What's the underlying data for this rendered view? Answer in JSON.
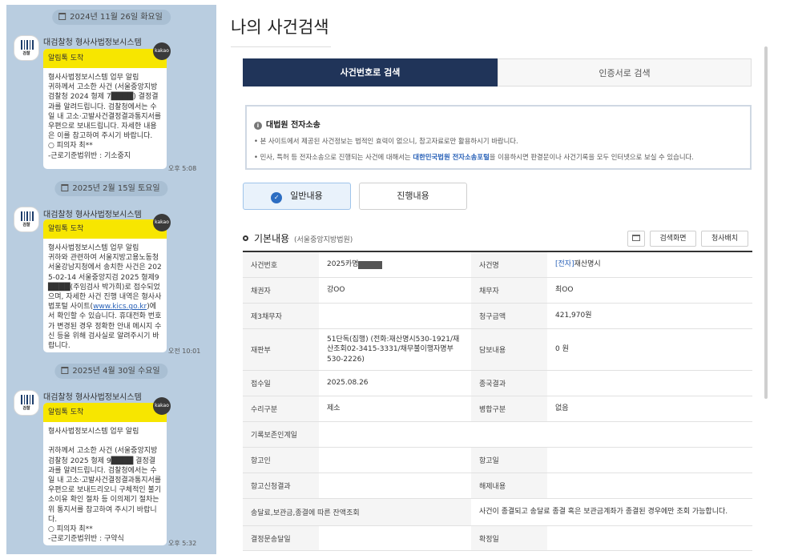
{
  "chat": {
    "sender": "대검찰청 형사사법정보시스템",
    "avatar_label": "검찰",
    "kakao_label": "kakao",
    "messages": [
      {
        "date": "2024년 11월 26일 화요일",
        "header": "알림톡 도착",
        "body": "형사사법정보시스템 업무 알림\n귀하께서 고소한 사건 (서울중앙지방검찰청 2024 형제 7████) 결정결과를 알려드립니다. 검찰청에서는 수일 내 고소·고발사건결정결과통지서를 우편으로 보내드립니다. 자세한 내용은 이를 참고하여 주시기 바랍니다.\n○ 피의자 최**\n-근로기준법위반 : 기소중지",
        "time": "오후 5:08"
      },
      {
        "date": "2025년 2월 15일 토요일",
        "header": "알림톡 도착",
        "body_before_link": "형사사법정보시스템 업무 알림\n귀하와 관련하여 서울지방고용노동청 서울강남지청에서 송치한 사건은 2025-02-14 서울중앙지검 2025 형제9████(주임검사 박가희)로 접수되었으며, 자세한 사건 진행 내역은 형사사법포털 사이트(",
        "link": "www.kics.go.kr",
        "body_after_link": ")에서 확인할 수 있습니다. 휴대전화 번호가 변경된 경우 정확한 안내 메시지 수신 등을 위해 검사실로 알려주시기 바랍니다.",
        "time": "오전 10:01"
      },
      {
        "date": "2025년 4월 30일 수요일",
        "header": "알림톡 도착",
        "body": "형사사법정보시스템 업무 알림\n\n귀하께서 고소한 사건 (서울중앙지방검찰청 2025 형제 9████ 결정결과를 알려드립니다. 검찰청에서는 수일 내 고소·고발사건결정결과통지서를 우편으로 보내드리오니 구체적인 불기소이유 확인 절차 등 이의제기 절차는 위 통지서를 참고하여 주시기 바랍니다.\n○ 피의자 최**\n-근로기준법위반 : 구약식",
        "time": "오후 5:32"
      }
    ]
  },
  "main": {
    "title": "나의 사건검색",
    "tabs": [
      "사건번호로 검색",
      "인증서로 검색"
    ],
    "notice": {
      "title": "대법원 전자소송",
      "line1": "• 본 사이트에서 제공된 사건정보는 법적인 효력이 없으니, 참고자료로만 활용하시기 바랍니다.",
      "line2_before": "• 민사, 특허 등 전자소송으로 진행되는 사건에 대해서는 ",
      "line2_link": "대한민국법원 전자소송포털",
      "line2_after": "을 이용하시면 판결문이나 사건기록을 모두 인터넷으로 보실 수 있습니다."
    },
    "sub_tabs": [
      "일반내용",
      "진행내용"
    ],
    "section": {
      "title": "기본내용",
      "court": "(서울중앙지방법원)",
      "buttons": [
        "검색화면",
        "청사배치"
      ]
    },
    "table": {
      "rows": [
        {
          "l1": "사건번호",
          "v1": "2025카명",
          "l2": "사건명",
          "v2_tag": "[전자]",
          "v2": "재산명시"
        },
        {
          "l1": "채권자",
          "v1": "강OO",
          "l2": "채무자",
          "v2": "최OO"
        },
        {
          "l1": "제3채무자",
          "v1": "",
          "l2": "청구금액",
          "v2": "421,970원"
        },
        {
          "l1": "재판부",
          "v1": "51단독(집행) (전화:재산명시530-1921/재산조회02-3415-3331/채무불이행자명부530-2226)",
          "l2": "담보내용",
          "v2": "0 원"
        },
        {
          "l1": "접수일",
          "v1": "2025.08.26",
          "l2": "종국결과",
          "v2": ""
        },
        {
          "l1": "수리구분",
          "v1": "제소",
          "l2": "병합구분",
          "v2": "없음"
        },
        {
          "l1": "기록보존인계일",
          "v1": "",
          "l2": "",
          "v2": ""
        },
        {
          "l1": "항고인",
          "v1": "",
          "l2": "항고일",
          "v2": ""
        },
        {
          "l1": "항고신청결과",
          "v1": "",
          "l2": "해제내용",
          "v2": ""
        },
        {
          "l1": "송달료,보관금,종결에 따른 잔액조회",
          "v1": "",
          "l2": "",
          "v2": "사건이 종결되고 송달료 종결 혹은 보관금계좌가 종결된 경우에만 조회 가능합니다."
        },
        {
          "l1": "결정문송달일",
          "v1": "",
          "l2": "확정일",
          "v2": ""
        }
      ]
    }
  }
}
